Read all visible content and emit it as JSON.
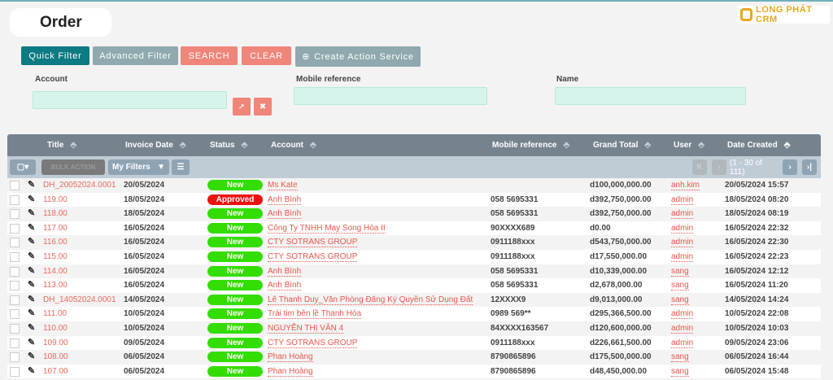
{
  "page_title": "Order",
  "logo_text": "LONG PHÁT CRM",
  "buttons": {
    "quick_filter": "Quick Filter",
    "advanced_filter": "Advanced Filter",
    "search": "SEARCH",
    "clear": "CLEAR",
    "create_action": "Create Action Service"
  },
  "filters": {
    "account": "Account",
    "mobile": "Mobile reference",
    "name": "Name"
  },
  "columns": [
    "Title",
    "Invoice Date",
    "Status",
    "Account",
    "Mobile reference",
    "Grand Total",
    "User",
    "Date Created"
  ],
  "toolbar": {
    "bulk_action": "BULK ACTION",
    "my_filters": "My Filters",
    "pagination": "(1 - 30 of 111)"
  },
  "colors": {
    "new": "#33dd00",
    "approved": "#ee1111"
  },
  "rows": [
    {
      "title": "DH_20052024.0001",
      "date": "20/05/2024",
      "status": "New",
      "account": "Ms Kate",
      "mobile": "",
      "total": "d100,000,000.00",
      "user": "anh.kim",
      "created": "20/05/2024 15:57"
    },
    {
      "title": "119.00",
      "date": "18/05/2024",
      "status": "Approved",
      "account": "Anh Bình",
      "mobile": "058 5695331",
      "total": "d392,750,000.00",
      "user": "admin",
      "created": "18/05/2024 08:20"
    },
    {
      "title": "118.00",
      "date": "18/05/2024",
      "status": "New",
      "account": "Anh Bình",
      "mobile": "058 5695331",
      "total": "d392,750,000.00",
      "user": "admin",
      "created": "18/05/2024 08:19"
    },
    {
      "title": "117.00",
      "date": "16/05/2024",
      "status": "New",
      "account": "Công Ty TNHH May Song Hòa II",
      "mobile": "90XXXX689",
      "total": "d0.00",
      "user": "admin",
      "created": "16/05/2024 22:32"
    },
    {
      "title": "116.00",
      "date": "16/05/2024",
      "status": "New",
      "account": "CTY SOTRANS GROUP",
      "mobile": "0911188xxx",
      "total": "d543,750,000.00",
      "user": "admin",
      "created": "16/05/2024 22:30"
    },
    {
      "title": "115.00",
      "date": "16/05/2024",
      "status": "New",
      "account": "CTY SOTRANS GROUP",
      "mobile": "0911188xxx",
      "total": "d17,550,000.00",
      "user": "admin",
      "created": "16/05/2024 22:23"
    },
    {
      "title": "114.00",
      "date": "16/05/2024",
      "status": "New",
      "account": "Anh Bình",
      "mobile": "058 5695331",
      "total": "d10,339,000.00",
      "user": "sang",
      "created": "16/05/2024 12:12"
    },
    {
      "title": "113.00",
      "date": "16/05/2024",
      "status": "New",
      "account": "Anh Bình",
      "mobile": "058 5695331",
      "total": "d2,678,000.00",
      "user": "sang",
      "created": "16/05/2024 11:20"
    },
    {
      "title": "DH_14052024.0001",
      "date": "14/05/2024",
      "status": "New",
      "account": "Lê Thanh Duy_Văn Phòng Đăng Ký Quyền Sử Dụng Đất",
      "mobile": "12XXXX9",
      "total": "d9,013,000.00",
      "user": "sang",
      "created": "14/05/2024 14:24"
    },
    {
      "title": "111.00",
      "date": "10/05/2024",
      "status": "New",
      "account": "Trái tim bên lề Thanh Hóa",
      "mobile": "0989 569**",
      "total": "d295,366,500.00",
      "user": "admin",
      "created": "10/05/2024 22:08"
    },
    {
      "title": "110.00",
      "date": "10/05/2024",
      "status": "New",
      "account": "NGUYỄN THỊ VÂN 4",
      "mobile": "84XXXX163567",
      "total": "d120,600,000.00",
      "user": "admin",
      "created": "10/05/2024 10:03"
    },
    {
      "title": "109.00",
      "date": "09/05/2024",
      "status": "New",
      "account": "CTY SOTRANS GROUP",
      "mobile": "0911188xxx",
      "total": "d226,661,500.00",
      "user": "admin",
      "created": "09/05/2024 23:06"
    },
    {
      "title": "108.00",
      "date": "06/05/2024",
      "status": "New",
      "account": "Phan Hoàng",
      "mobile": "8790865896",
      "total": "d175,500,000.00",
      "user": "sang",
      "created": "06/05/2024 16:44"
    },
    {
      "title": "107.00",
      "date": "06/05/2024",
      "status": "New",
      "account": "Phan Hoàng",
      "mobile": "8790865896",
      "total": "d48,450,000.00",
      "user": "sang",
      "created": "06/05/2024 15:48"
    }
  ]
}
